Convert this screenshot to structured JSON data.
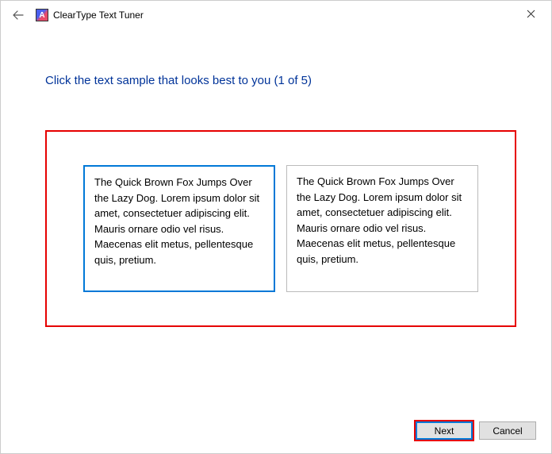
{
  "window": {
    "title": "ClearType Text Tuner"
  },
  "heading": "Click the text sample that looks best to you (1 of 5)",
  "samples": {
    "left": "The Quick Brown Fox Jumps Over the Lazy Dog. Lorem ipsum dolor sit amet, consectetuer adipiscing elit. Mauris ornare odio vel risus. Maecenas elit metus, pellentesque quis, pretium.",
    "right": "The Quick Brown Fox Jumps Over the Lazy Dog. Lorem ipsum dolor sit amet, consectetuer adipiscing elit. Mauris ornare odio vel risus. Maecenas elit metus, pellentesque quis, pretium."
  },
  "buttons": {
    "next": "Next",
    "cancel": "Cancel"
  },
  "icons": {
    "app_letter": "A"
  }
}
